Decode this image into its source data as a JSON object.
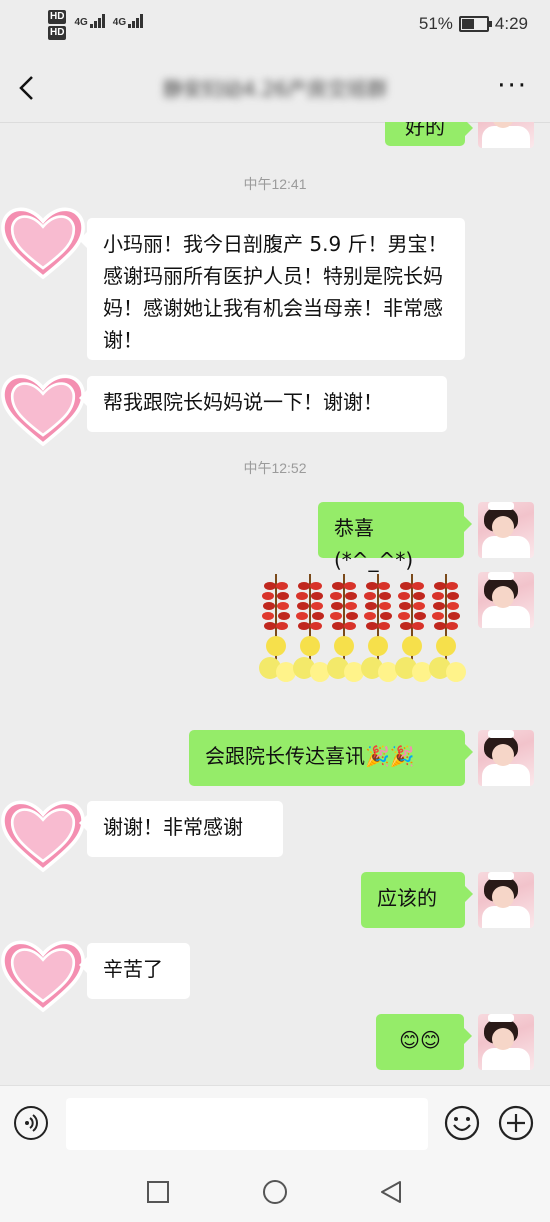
{
  "status_bar": {
    "hd1": "HD",
    "hd2": "HD",
    "net1": "4G",
    "net2": "4G",
    "battery": "51%",
    "time": "4:29"
  },
  "header": {
    "title": "静安妇幼4.26产房交班群",
    "back_icon": "chevron-left-icon",
    "more_icon": "more-dots-icon"
  },
  "messages": {
    "partial_top": "好的",
    "time1": "中午12:41",
    "msg1": "小玛丽！我今日剖腹产 5.9 斤！男宝！感谢玛丽所有医护人员！特别是院长妈妈！感谢她让我有机会当母亲！非常感谢！",
    "msg2": "帮我跟院长妈妈说一下！谢谢！",
    "time2": "中午12:52",
    "msg3": "恭喜(*^_^*)",
    "msg4": "会跟院长传达喜讯",
    "msg4_emoji": "🎉🎉",
    "msg5": "谢谢！非常感谢",
    "msg6": "应该的",
    "msg7": "辛苦了",
    "msg8": "😊😊"
  },
  "input_bar": {
    "voice_icon": "voice-icon",
    "placeholder": "",
    "emoji_icon": "emoji-icon",
    "plus_icon": "plus-icon"
  },
  "colors": {
    "outgoing": "#95ec69",
    "incoming": "#ffffff",
    "background": "#ededed"
  }
}
